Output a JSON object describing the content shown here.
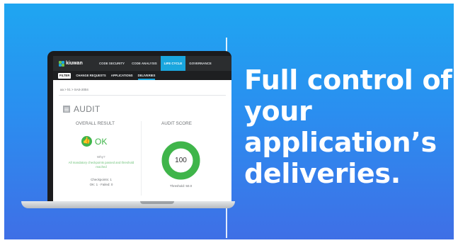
{
  "headline": {
    "lines": [
      "Full control of",
      "your",
      "application’s",
      "deliveries."
    ]
  },
  "app": {
    "brand": "kiuwan",
    "top_nav": [
      {
        "label": "CODE SECURITY",
        "active": false
      },
      {
        "label": "CODE ANALYSIS",
        "active": false
      },
      {
        "label": "LIFE CYCLE",
        "active": true
      },
      {
        "label": "GOVERNANCE",
        "active": false
      }
    ],
    "sub_nav": {
      "filter": "FILTER",
      "items": [
        {
          "label": "CHANGE REQUESTS",
          "selected": false
        },
        {
          "label": "APPLICATIONS",
          "selected": false
        },
        {
          "label": "DELIVERIES",
          "selected": true
        }
      ]
    },
    "breadcrumb": "aa > lr1 > SAS-2004",
    "audit": {
      "title": "AUDIT",
      "overall_result_label": "OVERALL RESULT",
      "result": "OK",
      "why_label": "Why?",
      "note": "All mandatory checkpoints passed and threshold reached",
      "checkpoints": "Checkpoints: 1",
      "ok_failed": "OK: 1 · Failed: 0",
      "audit_score_label": "AUDIT SCORE",
      "score": "100",
      "score_value": 100,
      "threshold": "Threshold: 50.0"
    }
  },
  "colors": {
    "banner_top": "#1fa6f1",
    "banner_bottom": "#3f6fe6",
    "accent": "#1aa6de",
    "ok_green": "#3fb54a"
  }
}
